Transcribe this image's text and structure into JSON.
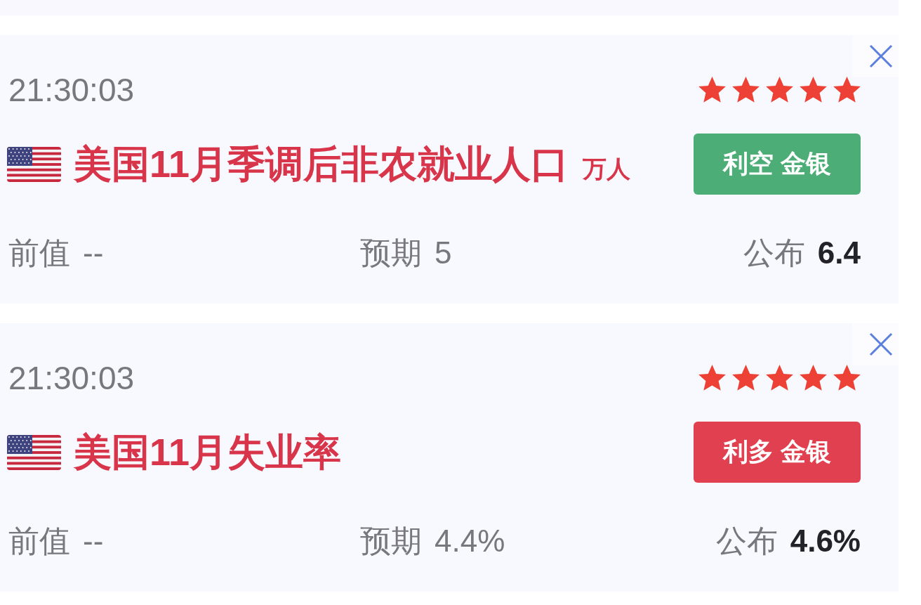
{
  "events": [
    {
      "time": "21:30:03",
      "stars": 5,
      "title": "美国11月季调后非农就业人口",
      "unit": "万人",
      "impact": {
        "label": "利空 金银",
        "color": "#4cad76"
      },
      "previous": {
        "label": "前值",
        "value": "--"
      },
      "forecast": {
        "label": "预期",
        "value": "5"
      },
      "actual": {
        "label": "公布",
        "value": "6.4"
      }
    },
    {
      "time": "21:30:03",
      "stars": 5,
      "title": "美国11月失业率",
      "impact": {
        "label": "利多 金银",
        "color": "#e0404f"
      },
      "previous": {
        "label": "前值",
        "value": "--"
      },
      "forecast": {
        "label": "预期",
        "value": "4.4%"
      },
      "actual": {
        "label": "公布",
        "value": "4.6%"
      }
    }
  ]
}
